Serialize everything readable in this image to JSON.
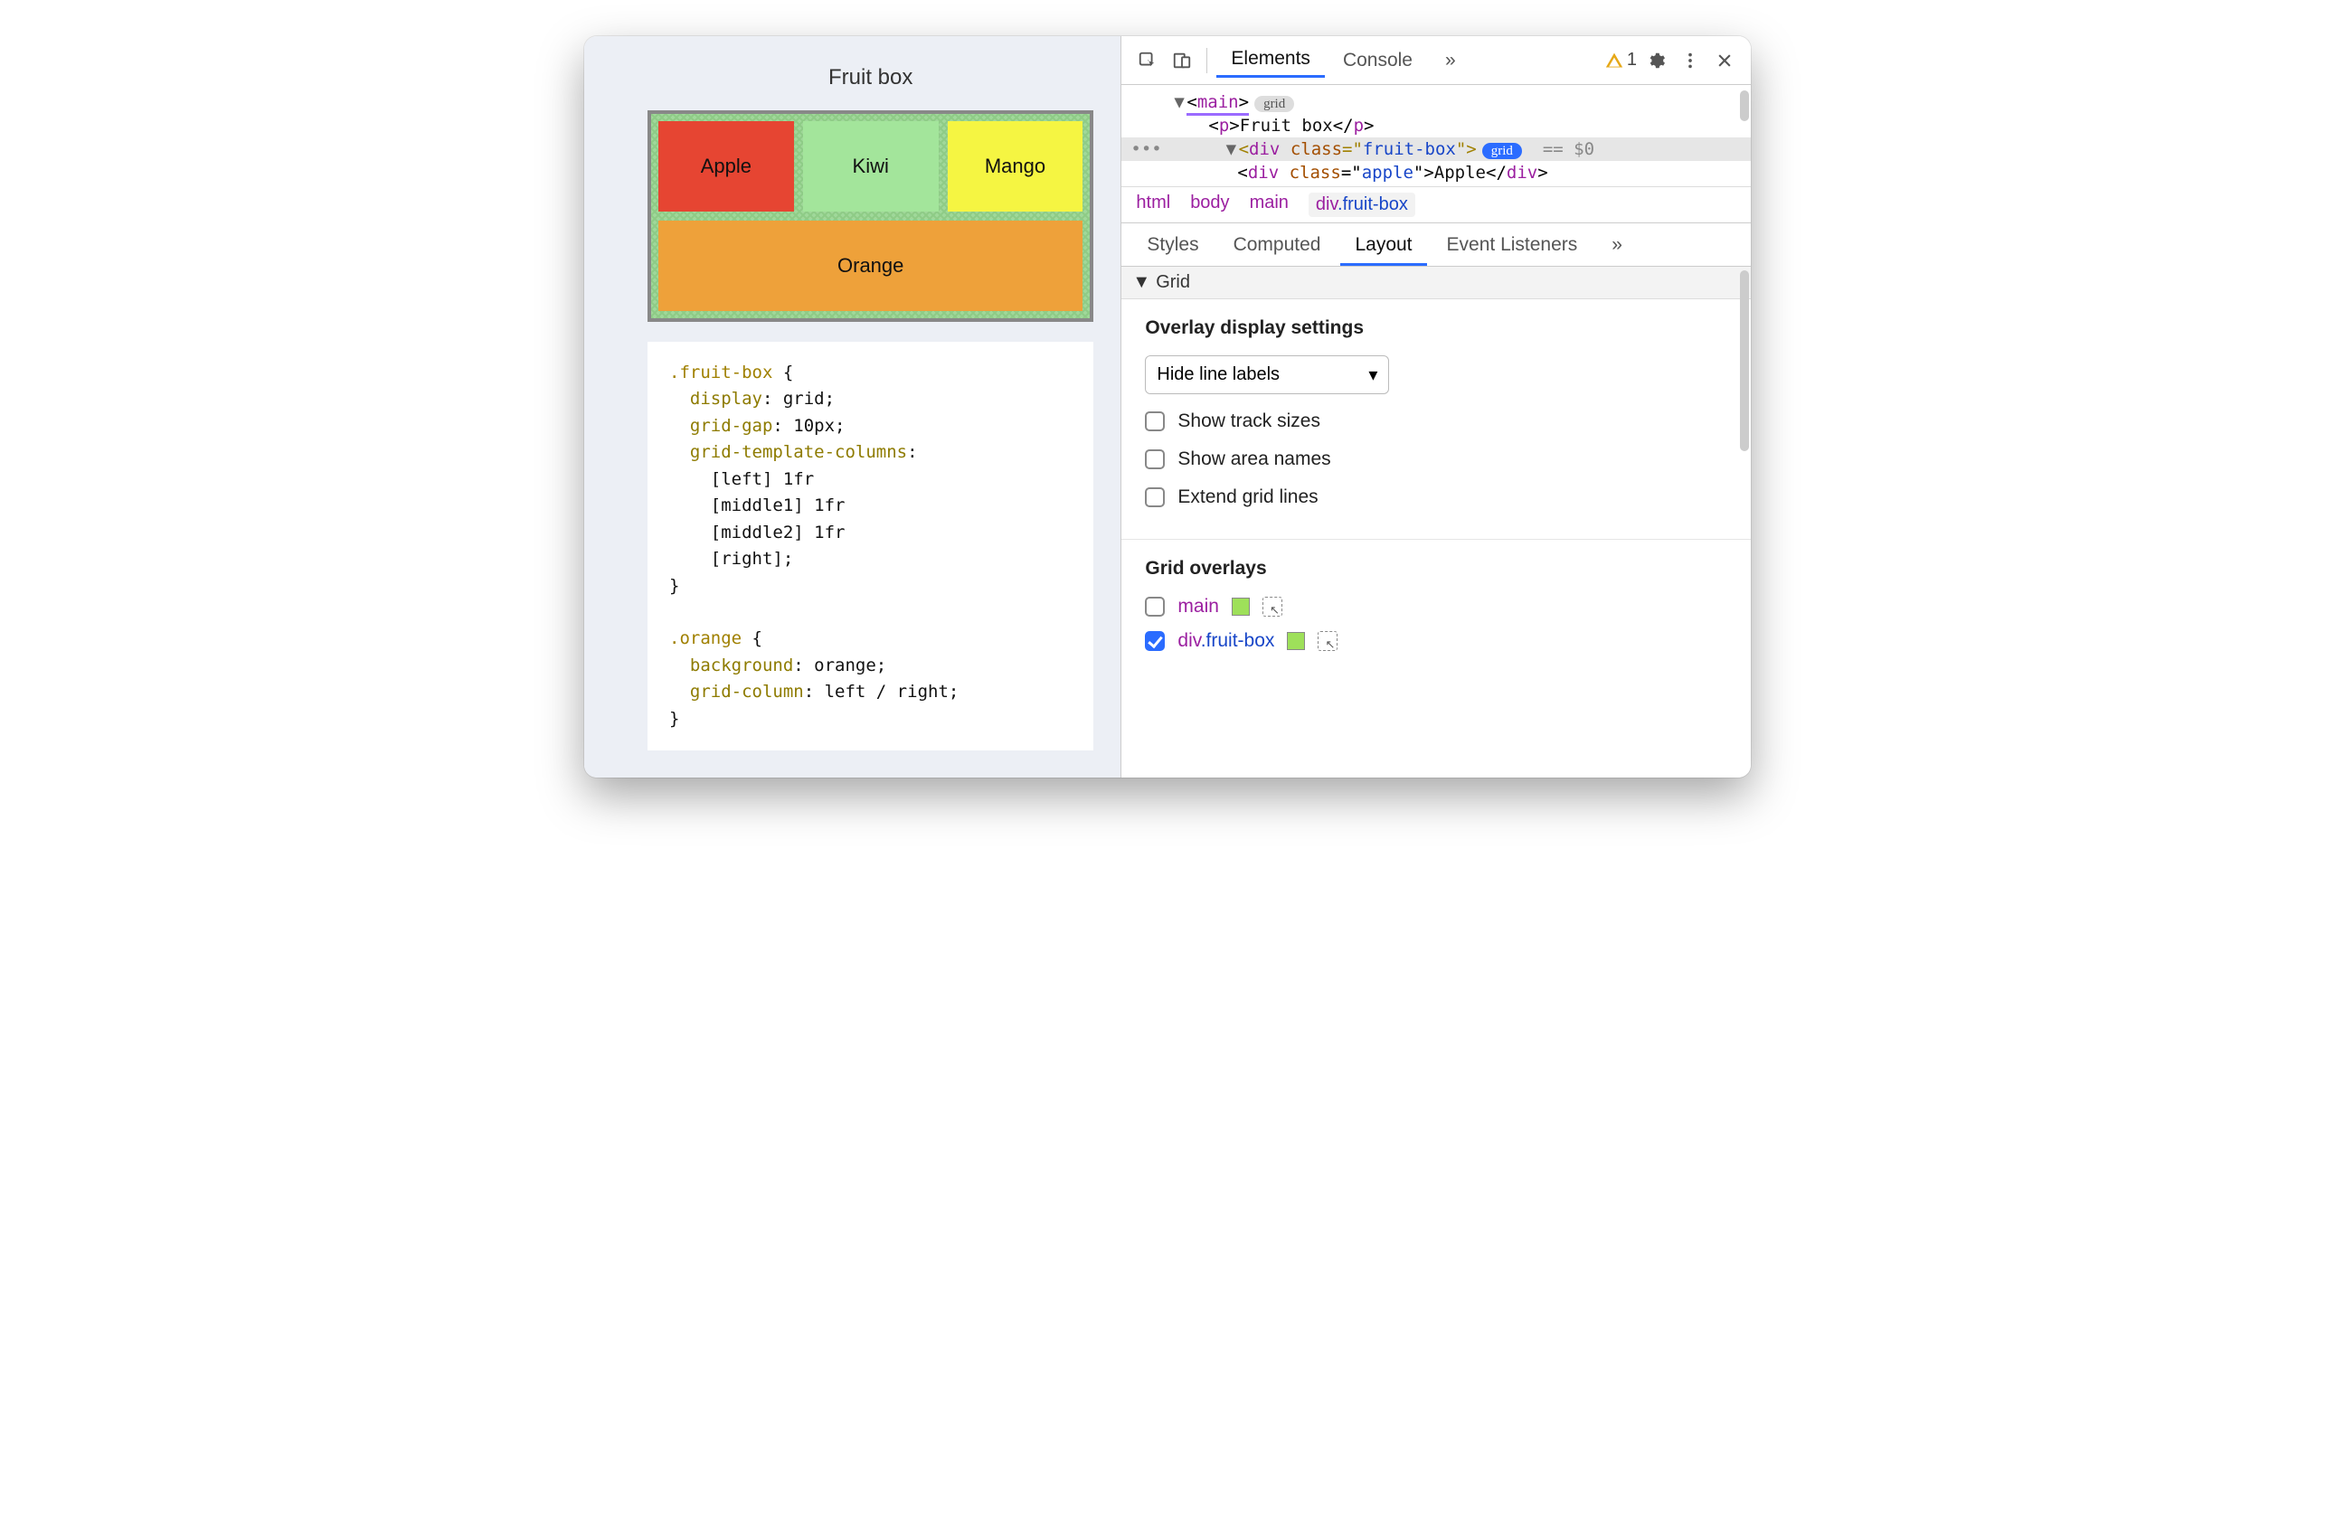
{
  "page": {
    "title": "Fruit box",
    "fruits": {
      "apple": "Apple",
      "kiwi": "Kiwi",
      "mango": "Mango",
      "orange": "Orange"
    },
    "css": ".fruit-box {\n  display: grid;\n  grid-gap: 10px;\n  grid-template-columns:\n    [left] 1fr\n    [middle1] 1fr\n    [middle2] 1fr\n    [right];\n}\n\n.orange {\n  background: orange;\n  grid-column: left / right;\n}"
  },
  "devtools": {
    "tabs": {
      "elements": "Elements",
      "console": "Console"
    },
    "more": "»",
    "warn_count": "1",
    "dom": {
      "main_tag": "main",
      "main_badge": "grid",
      "p_text": "Fruit box",
      "div_class": "fruit-box",
      "div_badge": "grid",
      "sel_suffix": "== $0",
      "apple_class": "apple",
      "apple_text": "Apple"
    },
    "crumbs": [
      "html",
      "body",
      "main",
      "div.fruit-box"
    ],
    "subtabs": {
      "styles": "Styles",
      "computed": "Computed",
      "layout": "Layout",
      "listeners": "Event Listeners"
    },
    "grid_header": "Grid",
    "overlay_settings": {
      "title": "Overlay display settings",
      "select": "Hide line labels",
      "opts": [
        "Show track sizes",
        "Show area names",
        "Extend grid lines"
      ]
    },
    "grid_overlays": {
      "title": "Grid overlays",
      "items": [
        {
          "name": "main",
          "checked": false
        },
        {
          "name": "div.fruit-box",
          "checked": true
        }
      ]
    }
  }
}
